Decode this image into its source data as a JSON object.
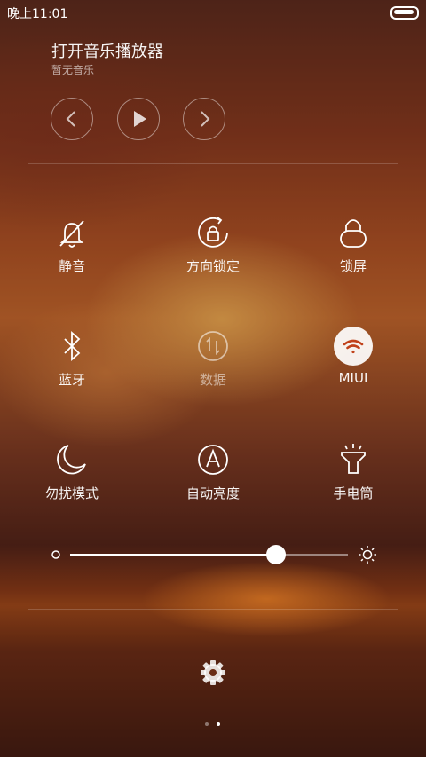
{
  "status_bar": {
    "time": "晚上11:01",
    "battery_icon": "battery-icon"
  },
  "music": {
    "title": "打开音乐播放器",
    "subtitle": "暂无音乐",
    "controls": [
      "previous-icon",
      "play-icon",
      "next-icon"
    ]
  },
  "toggles": [
    {
      "label": "静音",
      "icon": "bell-muted-icon",
      "active": false,
      "dimmed": false
    },
    {
      "label": "方向锁定",
      "icon": "rotation-lock-icon",
      "active": false,
      "dimmed": false
    },
    {
      "label": "锁屏",
      "icon": "lock-icon",
      "active": false,
      "dimmed": false
    },
    {
      "label": "蓝牙",
      "icon": "bluetooth-icon",
      "active": false,
      "dimmed": false
    },
    {
      "label": "数据",
      "icon": "mobile-data-icon",
      "active": false,
      "dimmed": true
    },
    {
      "label": "MIUI",
      "icon": "wifi-icon",
      "active": true,
      "dimmed": false
    },
    {
      "label": "勿扰模式",
      "icon": "moon-icon",
      "active": false,
      "dimmed": false
    },
    {
      "label": "自动亮度",
      "icon": "auto-brightness-icon",
      "active": false,
      "dimmed": false
    },
    {
      "label": "手电筒",
      "icon": "flashlight-icon",
      "active": false,
      "dimmed": false
    }
  ],
  "brightness": {
    "level": 0.74,
    "low_icon": "brightness-low-icon",
    "high_icon": "sun-icon"
  },
  "settings": {
    "icon": "gear-icon"
  },
  "pager": {
    "pages": 2,
    "current": 2
  }
}
